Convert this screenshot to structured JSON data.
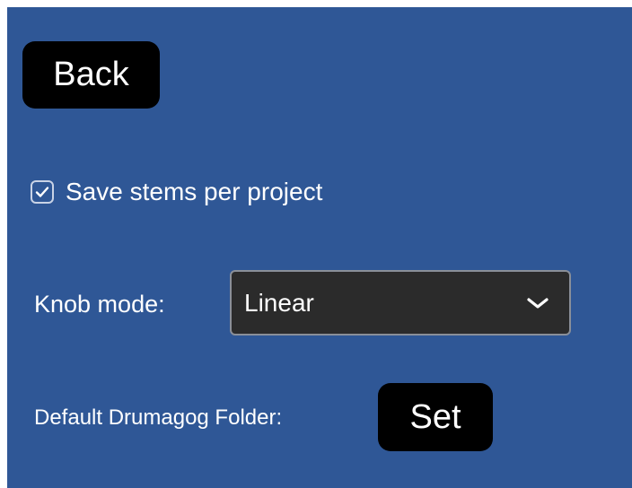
{
  "back_button": {
    "label": "Back"
  },
  "save_stems": {
    "label": "Save stems per project",
    "checked": true
  },
  "knob_mode": {
    "label": "Knob mode:",
    "selected": "Linear"
  },
  "default_folder": {
    "label": "Default Drumagog Folder:",
    "button_label": "Set"
  },
  "colors": {
    "background": "#2f5796",
    "button": "#000000",
    "select_background": "#2b2b2b",
    "text": "#ffffff"
  },
  "icons": {
    "checkbox": "check-icon",
    "dropdown": "chevron-down-icon"
  }
}
